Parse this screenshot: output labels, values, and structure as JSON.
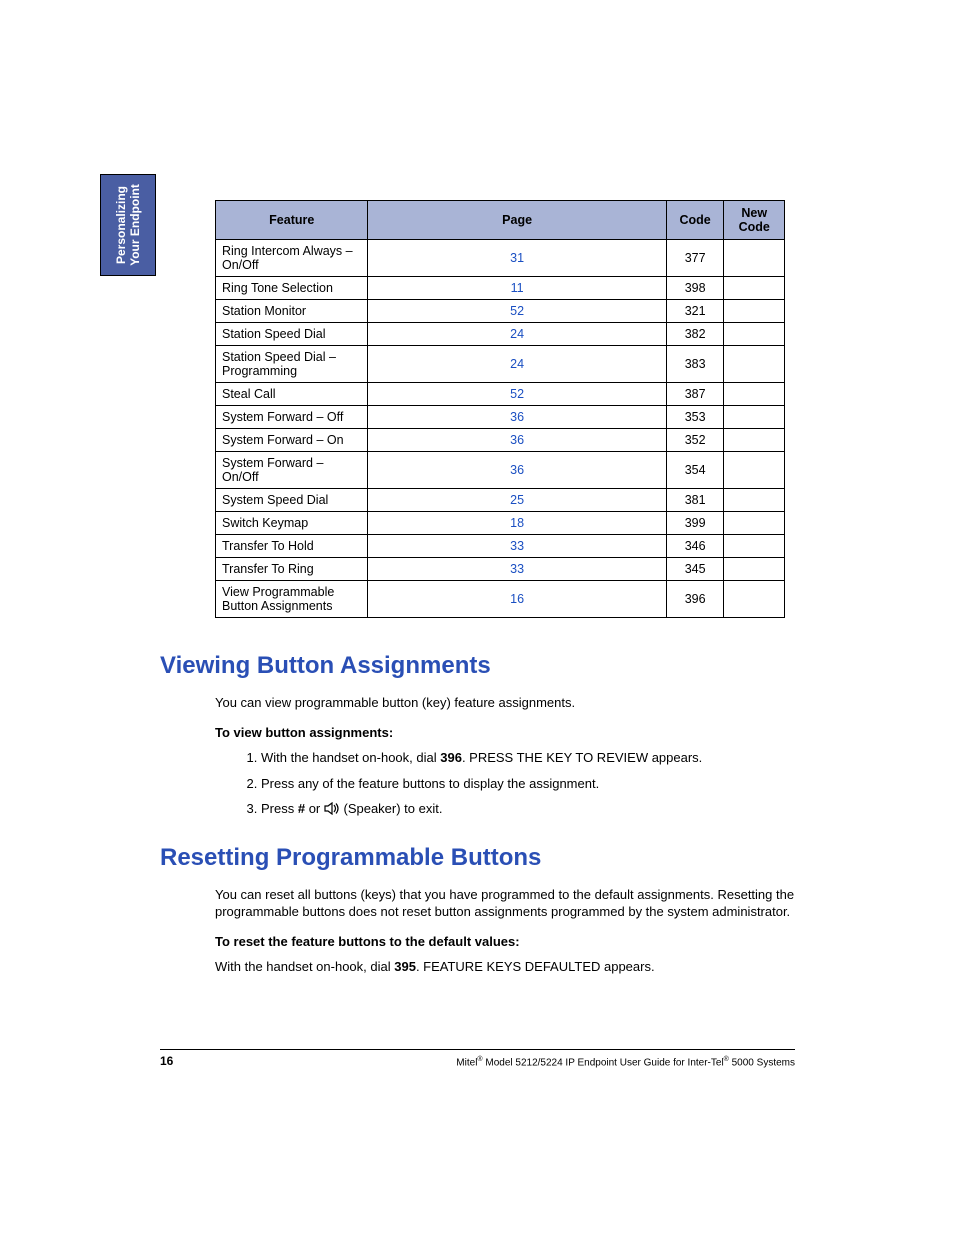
{
  "sidetab": {
    "line1": "Personalizing",
    "line2": "Your Endpoint"
  },
  "table": {
    "headers": {
      "feature": "Feature",
      "page": "Page",
      "code": "Code",
      "newcode": "New Code"
    },
    "rows": [
      {
        "feature": "Ring Intercom Always – On/Off",
        "page": "31",
        "code": "377"
      },
      {
        "feature": "Ring Tone Selection",
        "page": "11",
        "code": "398"
      },
      {
        "feature": "Station Monitor",
        "page": "52",
        "code": "321"
      },
      {
        "feature": "Station Speed Dial",
        "page": "24",
        "code": "382"
      },
      {
        "feature": "Station Speed Dial – Programming",
        "page": "24",
        "code": "383"
      },
      {
        "feature": "Steal Call",
        "page": "52",
        "code": "387"
      },
      {
        "feature": "System Forward – Off",
        "page": "36",
        "code": "353"
      },
      {
        "feature": "System Forward – On",
        "page": "36",
        "code": "352"
      },
      {
        "feature": "System Forward – On/Off",
        "page": "36",
        "code": "354"
      },
      {
        "feature": "System Speed Dial",
        "page": "25",
        "code": "381"
      },
      {
        "feature": "Switch Keymap",
        "page": "18",
        "code": "399"
      },
      {
        "feature": "Transfer To Hold",
        "page": "33",
        "code": "346"
      },
      {
        "feature": "Transfer To Ring",
        "page": "33",
        "code": "345"
      },
      {
        "feature": "View Programmable Button Assignments",
        "page": "16",
        "code": "396"
      }
    ]
  },
  "section1": {
    "heading": "Viewing Button Assignments",
    "intro": "You can view programmable button (key) feature assignments.",
    "subhead": "To view button assignments:",
    "steps": {
      "s1a": "With the handset on-hook, dial ",
      "s1b": "396",
      "s1c": ". PRESS THE KEY TO REVIEW appears.",
      "s2": "Press any of the feature buttons to display the assignment.",
      "s3a": "Press ",
      "s3b": "#",
      "s3c": " or ",
      "s3d": " (Speaker) to exit."
    }
  },
  "section2": {
    "heading": "Resetting Programmable Buttons",
    "intro": "You can reset all buttons (keys) that you have programmed to the default assignments. Resetting the programmable buttons does not reset button assignments programmed by the system administrator.",
    "subhead": "To reset the feature buttons to the default values:",
    "instr_a": "With the handset on-hook, dial ",
    "instr_b": "395",
    "instr_c": ". FEATURE KEYS DEFAULTED appears."
  },
  "footer": {
    "page": "16",
    "title_a": "Mitel",
    "title_b": " Model 5212/5224 IP Endpoint User Guide for Inter-Tel",
    "title_c": " 5000 Systems"
  }
}
